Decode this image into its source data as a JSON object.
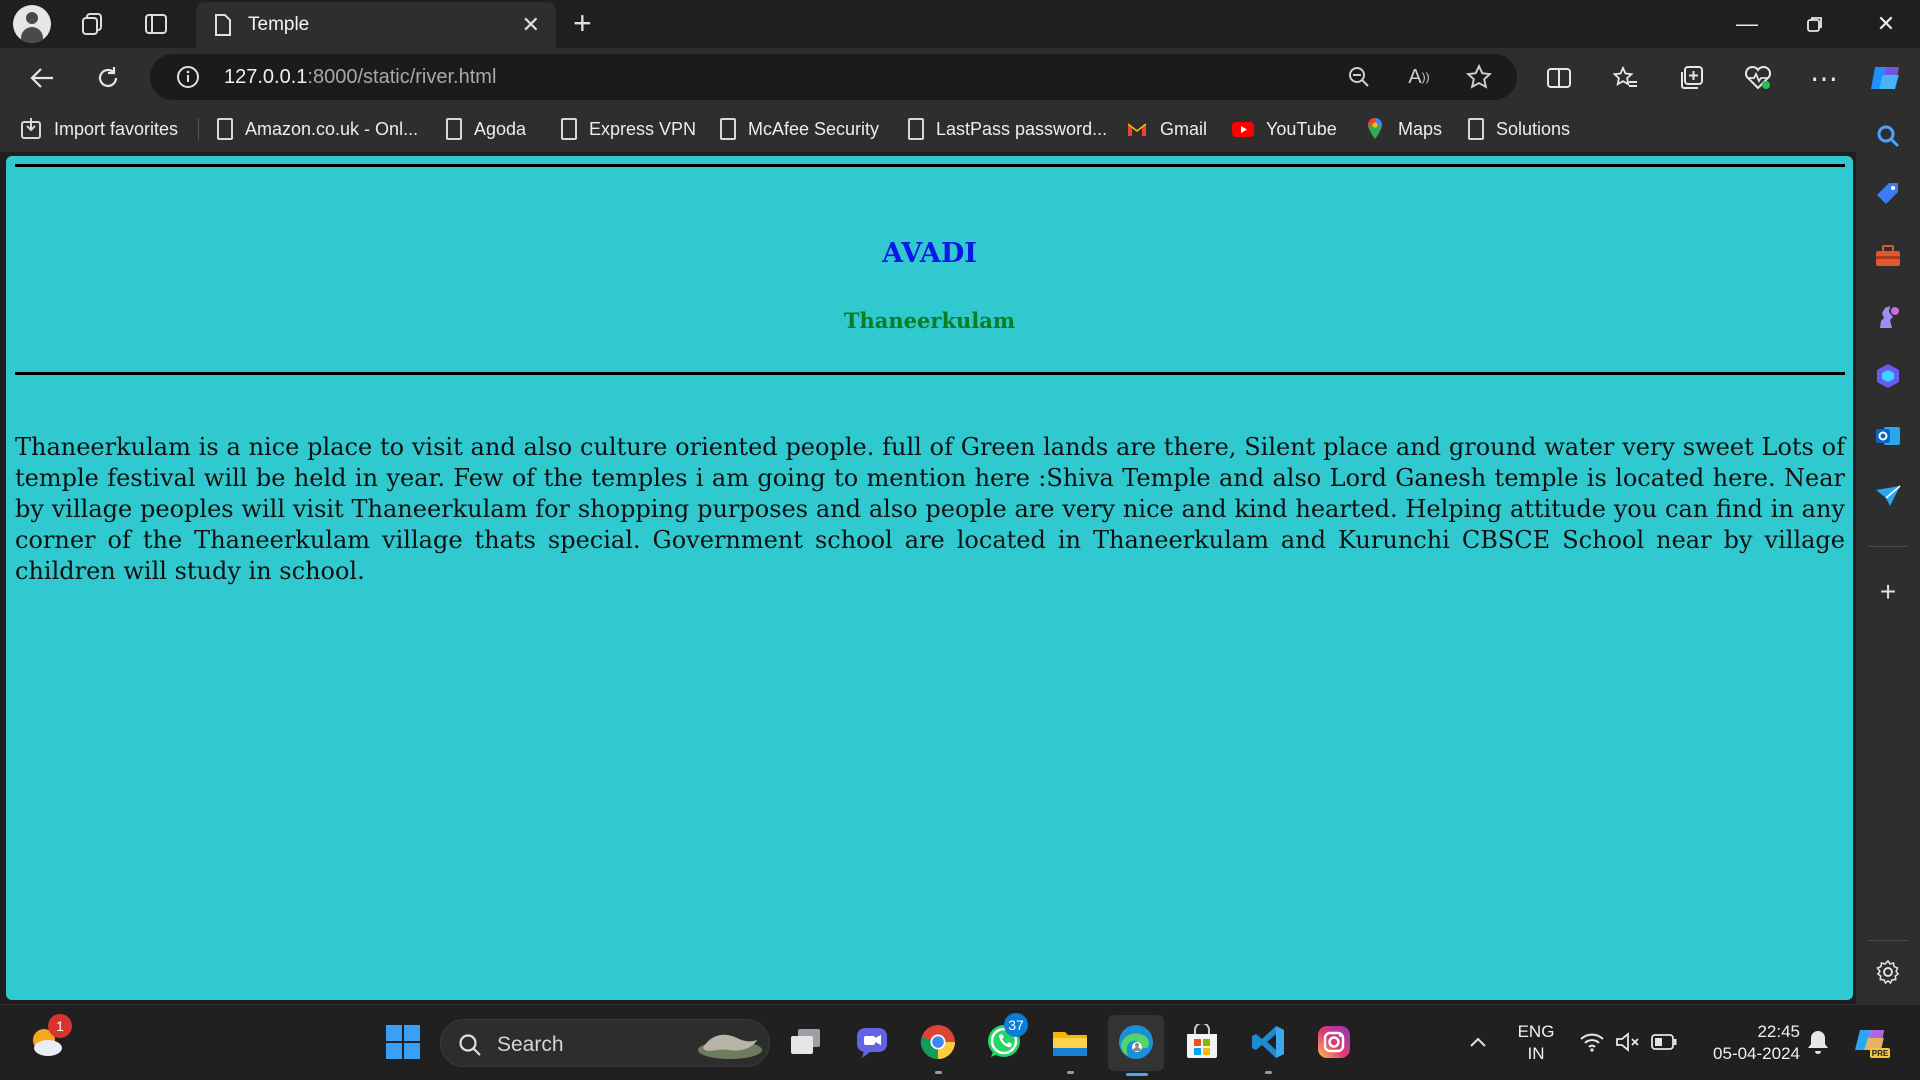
{
  "browser": {
    "tab_title": "Temple",
    "url_host": "127.0.0.1",
    "url_rest": ":8000/static/river.html"
  },
  "favorites": [
    {
      "label": "Import favorites",
      "icon": "import-icon"
    },
    {
      "label": "Amazon.co.uk - Onl...",
      "icon": "page-icon"
    },
    {
      "label": "Agoda",
      "icon": "page-icon"
    },
    {
      "label": "Express VPN",
      "icon": "page-icon"
    },
    {
      "label": "McAfee Security",
      "icon": "page-icon"
    },
    {
      "label": "LastPass password...",
      "icon": "page-icon"
    },
    {
      "label": "Gmail",
      "icon": "gmail-icon"
    },
    {
      "label": "YouTube",
      "icon": "youtube-icon"
    },
    {
      "label": "Maps",
      "icon": "maps-icon"
    },
    {
      "label": "Solutions",
      "icon": "page-icon"
    }
  ],
  "page": {
    "heading": "AVADI",
    "subheading": "Thaneerkulam",
    "paragraph": "Thaneerkulam is a nice place to visit and also culture oriented people. full of Green lands are there, Silent place and ground water very sweet Lots of temple festival will be held in year. Few of the temples i am going to mention here :Shiva Temple and also Lord Ganesh temple is located here. Near by village peoples will visit Thaneerkulam for shopping purposes and also people are very nice and kind hearted. Helping attitude you can find in any corner of the Thaneerkulam village thats special. Government school are located in Thaneerkulam and Kurunchi CBSCE School near by village children will study in school.",
    "background_color": "#2fc9cf",
    "heading_color": "#0b17e6",
    "subheading_color": "#0a7d24"
  },
  "taskbar": {
    "search_label": "Search",
    "weather_badge": "1",
    "whatsapp_badge": "37",
    "language_line1": "ENG",
    "language_line2": "IN",
    "time": "22:45",
    "date": "05-04-2024"
  }
}
